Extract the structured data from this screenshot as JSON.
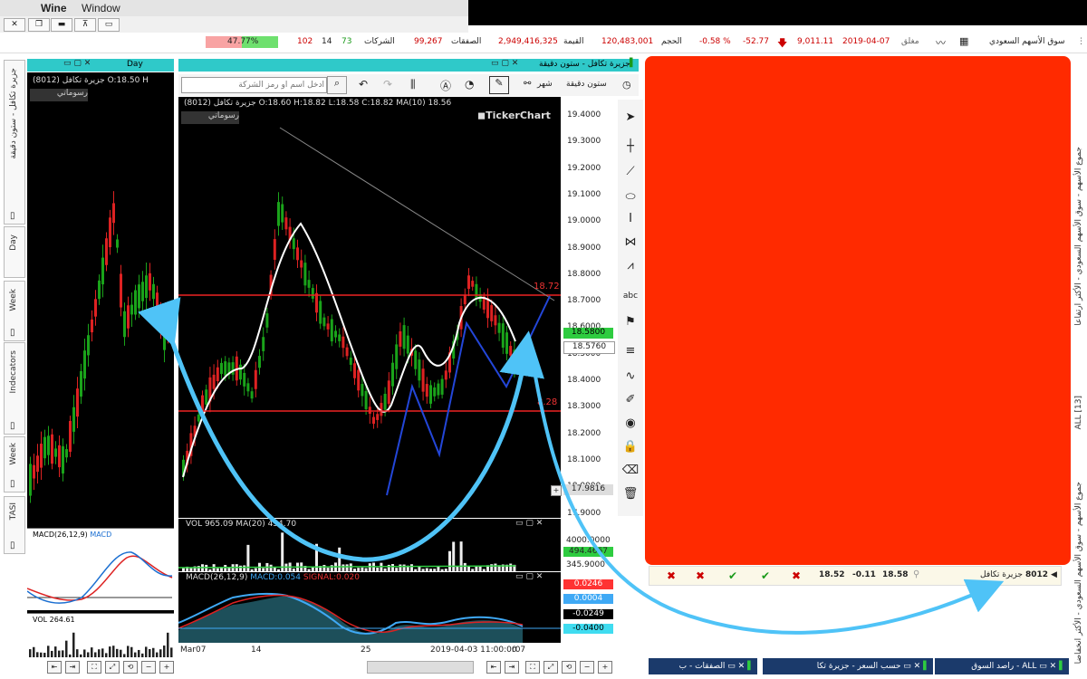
{
  "menubar": {
    "apple_glyph": "",
    "app_name": "Wine",
    "window_menu": "Window"
  },
  "statsbar": {
    "market_name": "سوق الأسهم السعودي",
    "date": "2019-04-07",
    "status": "مغلق",
    "index_value": "9,011.11",
    "change": "-52.77",
    "change_pct": "-0.58 %",
    "volume_label": "الحجم",
    "volume": "120,483,001",
    "value_label": "القيمة",
    "value": "2,949,416,325",
    "trades_label": "الصفقات",
    "trades": "99,267",
    "companies_label": "الشركات",
    "up_count": "73",
    "flat_count": "14",
    "down_count": "102",
    "ratio_pct": "47.77%"
  },
  "left_panel": {
    "period": "Day",
    "symbol_line": "(8012) جزيرة تكافل  O:18.50 H",
    "drawings_label": "رسوماتي",
    "macd_label": "MACD(26,12,9)",
    "macd_label2": "MACD",
    "vol_label": "VOL 264.61"
  },
  "main_chart": {
    "window_title": "جزيرة تكافل - ستون دقيقة",
    "search_placeholder": "ادخل اسم او رمز الشركة",
    "period_label": "ستون دقيقة",
    "month_label": "شهر",
    "ohlc": "(8012) جزيرة تكافل  O:18.60 H:18.82 L:18.58 C:18.82 MA(10) 18.56",
    "drawings_label": "رسوماتي",
    "watermark": "TickerChart",
    "price_axis": [
      "19.4000",
      "19.3000",
      "19.2000",
      "19.1000",
      "19.0000",
      "18.9000",
      "18.8000",
      "18.7000",
      "18.6000",
      "18.5000",
      "18.4000",
      "18.3000",
      "18.2000",
      "18.1000",
      "18.0000",
      "17.9000"
    ],
    "level_high": "18.72",
    "level_low": "8.28",
    "last_price": "18.5800",
    "cursor_price": "18.5760",
    "low_badge": "17.9816",
    "vol_line": "VOL 965.09  MA(20)  454.70",
    "vol_axis": [
      "4000.0000",
      "345.9000"
    ],
    "vol_badge": "494.4667",
    "macd_line": "MACD(26,12,9)",
    "macd_value": "MACD:0.054",
    "signal_value": "SIGNAL:0.020",
    "macd_axis": [
      "0.0246",
      "0.0004",
      "-0.0249",
      "-0.0400"
    ],
    "x_axis": [
      "Mar07",
      "14",
      "25",
      "2019-04-03 11:00:00",
      "r07"
    ]
  },
  "side_tabs": [
    "جزيرة تكافل - ستون دقيقة",
    "Day",
    "Week",
    "Indecators",
    "Week",
    "TASI"
  ],
  "right_panel": {
    "row_code": "8012",
    "row_name": "جزيرة تكافل",
    "row_last": "18.58",
    "row_change": "-0.11",
    "row_price": "18.52",
    "side_text": "جموع الأسهم - سوق الأسهم السعودي - الأكثر ارتفاعا",
    "all_label": "ALL [13]",
    "side_text2": "جموع الأسهم - سوق الأسهم السعودي - الأكثر انخفاضا"
  },
  "bottom_tabs": [
    "راصد السوق - ALL",
    "حسب السعر - جزيرة تكا",
    "الصفقات - ب"
  ],
  "colors": {
    "accent_teal": "#2fc9c9",
    "redact": "#ff2a00",
    "arrow": "#4fc3f7",
    "ma": "#ffffff",
    "up": "#1aa31a",
    "down": "#d22"
  }
}
